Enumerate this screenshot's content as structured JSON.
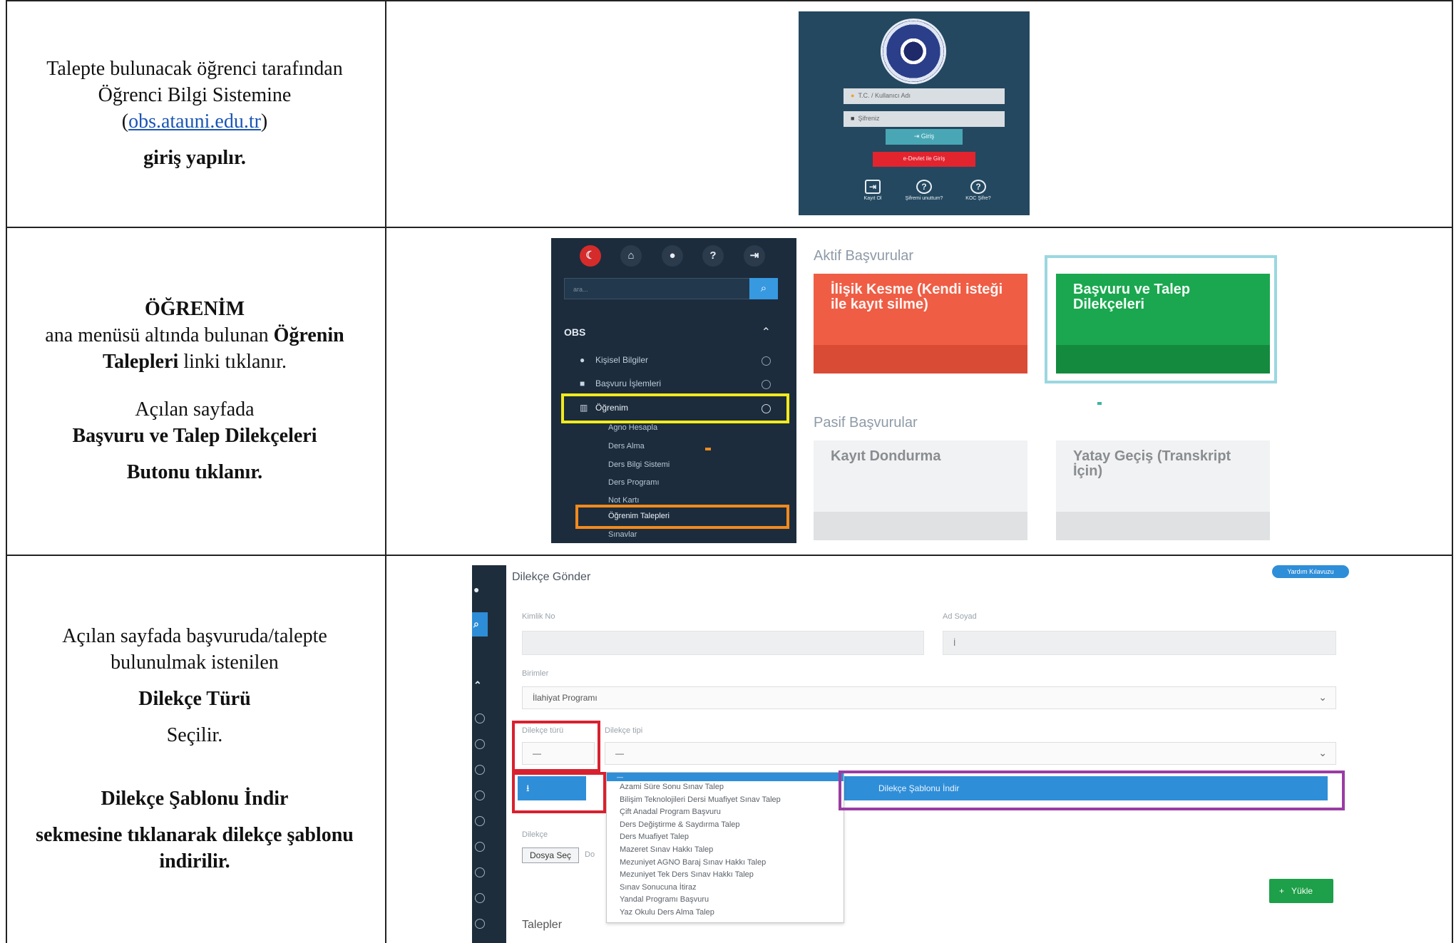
{
  "rows": [
    {
      "lines": [
        {
          "text": "Talepte bulunacak öğrenci tarafından",
          "bold": false
        },
        {
          "text": "Öğrenci Bilgi Sistemine",
          "bold": false
        },
        {
          "text_prefix": "(",
          "link": "obs.atauni.edu.tr",
          "text_suffix": ")"
        },
        {
          "text": "giriş yapılır.",
          "bold": true
        }
      ]
    },
    {
      "block1": {
        "heading": "ÖĞRENİM",
        "line2_pre": "ana menüsü altında bulunan ",
        "line2_bold": "Öğrenin",
        "line3_bold": "Talepleri",
        "line3_post": " linki tıklanır."
      },
      "block2": {
        "line1": "Açılan sayfada",
        "line2": "Başvuru ve Talep Dilekçeleri",
        "line3": "Butonu tıklanır."
      }
    },
    {
      "block1": {
        "line1": "Açılan sayfada başvuruda/talepte",
        "line2": "bulunulmak istenilen",
        "line3": "Dilekçe Türü",
        "line4": "Seçilir."
      },
      "block2": {
        "line1": "Dilekçe Şablonu İndir",
        "line2": "sekmesine tıklanarak dilekçe şablonu",
        "line3": "indirilir."
      }
    }
  ],
  "login_screen": {
    "username_placeholder": "T.C. / Kullanıcı Adı",
    "password_placeholder": "Şifreniz",
    "login_button": "Giriş",
    "edevlet_button": "e-Devlet ile Giriş",
    "links": [
      "Kayıt Ol",
      "Şifremi unuttum?",
      "KOC Şifre?"
    ]
  },
  "obs_menu": {
    "search_placeholder": "ara...",
    "section": "OBS",
    "items": [
      "Kişisel Bilgiler",
      "Başvuru İşlemleri",
      "Öğrenim"
    ],
    "subitems": [
      "Agno Hesapla",
      "Ders Alma",
      "Ders Bilgi Sistemi",
      "Ders Programı",
      "Not Kartı",
      "Öğrenim Talepleri",
      "Sınavlar"
    ]
  },
  "cards_panel": {
    "active_heading": "Aktif Başvurular",
    "passive_heading": "Pasif Başvurular",
    "cards": [
      "İlişik Kesme (Kendi isteği ile kayıt silme)",
      "Başvuru ve Talep Dilekçeleri",
      "Kayıt Dondurma",
      "Yatay Geçiş (Transkript İçin)"
    ]
  },
  "dilekce_form": {
    "title": "Dilekçe Gönder",
    "help_button": "Yardım Kılavuzu",
    "kimlik_label": "Kimlik No",
    "adsoyad_label": "Ad Soyad",
    "adsoyad_value": "İ",
    "birimler_label": "Birimler",
    "birimler_value": "İlahiyat Programı",
    "dilekce_turu_label": "Dilekçe türü",
    "dilekce_turu_value": "—",
    "dilekce_tipi_label": "Dilekçe tipi",
    "dilekce_tipi_value": "—",
    "download_icon": "⭳",
    "sablon_button": "Dilekçe Şablonu İndir",
    "dilekce_label": "Dilekçe",
    "file_button": "Dosya Seç",
    "file_status": "Do",
    "upload_button": "Yükle",
    "talepler_heading": "Talepler",
    "dropdown_selected": "—",
    "dropdown_options": [
      "Azami Süre Sonu Sınav Talep",
      "Bilişim Teknolojileri Dersi Muafiyet Sınav Talep",
      "Çift Anadal Program Başvuru",
      "Ders Değiştirme & Saydırma Talep",
      "Ders Muafiyet Talep",
      "Mazeret Sınav Hakkı Talep",
      "Mezuniyet AGNO Baraj Sınav Hakkı Talep",
      "Mezuniyet Tek Ders Sınav Hakkı Talep",
      "Sınav Sonucuna İtiraz",
      "Yandal Programı Başvuru",
      "Yaz Okulu Ders Alma Talep"
    ]
  }
}
